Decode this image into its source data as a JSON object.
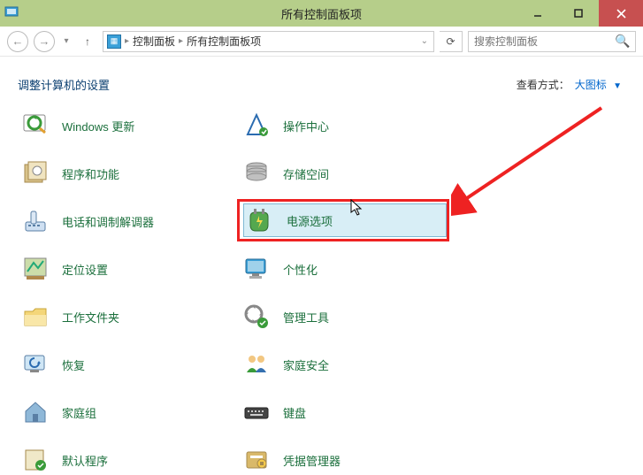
{
  "window": {
    "title": "所有控制面板项"
  },
  "breadcrumb": {
    "parts": [
      "控制面板",
      "所有控制面板项"
    ]
  },
  "search": {
    "placeholder": "搜索控制面板"
  },
  "header": {
    "title": "调整计算机的设置",
    "view_label": "查看方式：",
    "view_value": "大图标"
  },
  "items_left": [
    {
      "icon": "windows-update",
      "label": "Windows 更新"
    },
    {
      "icon": "programs",
      "label": "程序和功能"
    },
    {
      "icon": "phone",
      "label": "电话和调制解调器"
    },
    {
      "icon": "location",
      "label": "定位设置"
    },
    {
      "icon": "folder",
      "label": "工作文件夹"
    },
    {
      "icon": "recovery",
      "label": "恢复"
    },
    {
      "icon": "homegroup",
      "label": "家庭组"
    },
    {
      "icon": "default-programs",
      "label": "默认程序"
    }
  ],
  "items_right": [
    {
      "icon": "action-center",
      "label": "操作中心"
    },
    {
      "icon": "storage",
      "label": "存储空间"
    },
    {
      "icon": "power",
      "label": "电源选项"
    },
    {
      "icon": "personalization",
      "label": "个性化"
    },
    {
      "icon": "admin-tools",
      "label": "管理工具"
    },
    {
      "icon": "family-safety",
      "label": "家庭安全"
    },
    {
      "icon": "keyboard",
      "label": "键盘"
    },
    {
      "icon": "credential-manager",
      "label": "凭据管理器"
    }
  ]
}
